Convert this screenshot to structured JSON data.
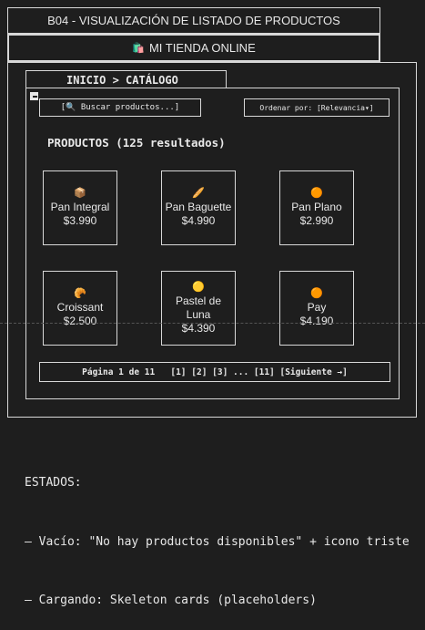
{
  "doc_title": "B04 - VISUALIZACIÓN DE LISTADO DE PRODUCTOS",
  "shop": {
    "icon": "🛍️",
    "name": "MI TIENDA ONLINE"
  },
  "breadcrumb": "INICIO > CATÁLOGO",
  "search": {
    "text": "[🔍 Buscar productos...]"
  },
  "sort": {
    "text": "Ordenar por: [Relevancia▾]"
  },
  "results_title": "PRODUCTOS (125 resultados)",
  "products": [
    {
      "icon": "📦",
      "name": "Pan Integral",
      "price": "$3.990"
    },
    {
      "icon": "🥖",
      "name": "Pan Baguette",
      "price": "$4.990"
    },
    {
      "icon": "🟠",
      "name": "Pan Plano",
      "price": "$2.990"
    },
    {
      "icon": "🥐",
      "name": "Croissant",
      "price": "$2.500"
    },
    {
      "icon": "🟡",
      "name": "Pastel de Luna",
      "price": "$4.390"
    },
    {
      "icon": "🟠",
      "name": "Pay",
      "price": "$4.190"
    }
  ],
  "pagination": "Página 1 de 11   [1] [2] [3] ... [11] [Siguiente →]",
  "states": {
    "heading": "ESTADOS:",
    "items": [
      "– Vacío: \"No hay productos disponibles\" + icono triste",
      "– Cargando: Skeleton cards (placeholders)"
    ]
  }
}
